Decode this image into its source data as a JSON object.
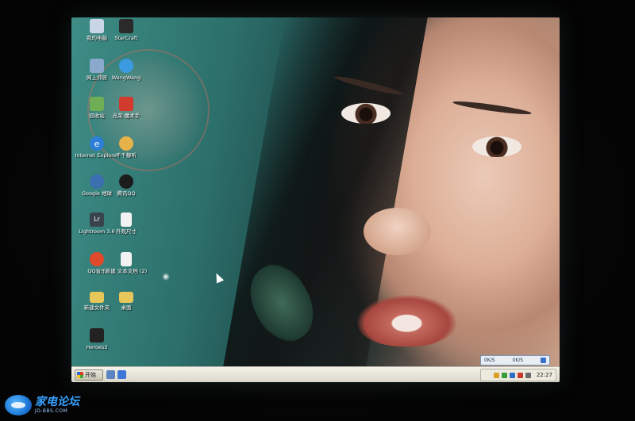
{
  "desktop": {
    "icons": [
      {
        "label": "我的电脑",
        "icon": "my-computer-icon",
        "color": "#c9d6e6"
      },
      {
        "label": "StarCraft",
        "icon": "starcraft-icon",
        "color": "#2a2a2a"
      },
      {
        "label": "网上邻居",
        "icon": "network-places-icon",
        "color": "#8aa9cc"
      },
      {
        "label": "WangWang",
        "icon": "wangwang-icon",
        "color": "#3a9be0"
      },
      {
        "label": "回收站",
        "icon": "recycle-bin-icon",
        "color": "#6fae55"
      },
      {
        "label": "光荣·魔术手",
        "icon": "photo-tool-icon",
        "color": "#d23a2e"
      },
      {
        "label": "Internet Explorer",
        "icon": "internet-explorer-icon",
        "color": "#2d7fd8"
      },
      {
        "label": "千千静听",
        "icon": "music-player-icon",
        "color": "#e8b24a"
      },
      {
        "label": "Google 地球",
        "icon": "google-earth-icon",
        "color": "#3b6fb0"
      },
      {
        "label": "腾讯QQ",
        "icon": "qq-icon",
        "color": "#1c1c1c"
      },
      {
        "label": "Lightroom 3.6",
        "icon": "lightroom-icon",
        "color": "#39434d"
      },
      {
        "label": "外观尺寸",
        "icon": "document-icon",
        "color": "#f2f2f2"
      },
      {
        "label": "QQ音乐",
        "icon": "qq-music-icon",
        "color": "#e0492b"
      },
      {
        "label": "新建 文本文档 (2)",
        "icon": "text-file-icon",
        "color": "#f2f2f2"
      },
      {
        "label": "新建文件夹",
        "icon": "folder-icon",
        "color": "#e7c65a"
      },
      {
        "label": "桌面",
        "icon": "folder-icon",
        "color": "#e7c65a"
      },
      {
        "label": "Heroes3",
        "icon": "heroes-icon",
        "color": "#222222"
      }
    ]
  },
  "taskbar": {
    "start_label": "开始",
    "clock": "22:27",
    "net_widget": {
      "upload": "0K/S",
      "download": "0K/S"
    }
  },
  "watermark": {
    "title": "家电论坛",
    "subtitle": "JD-BBS.COM"
  }
}
